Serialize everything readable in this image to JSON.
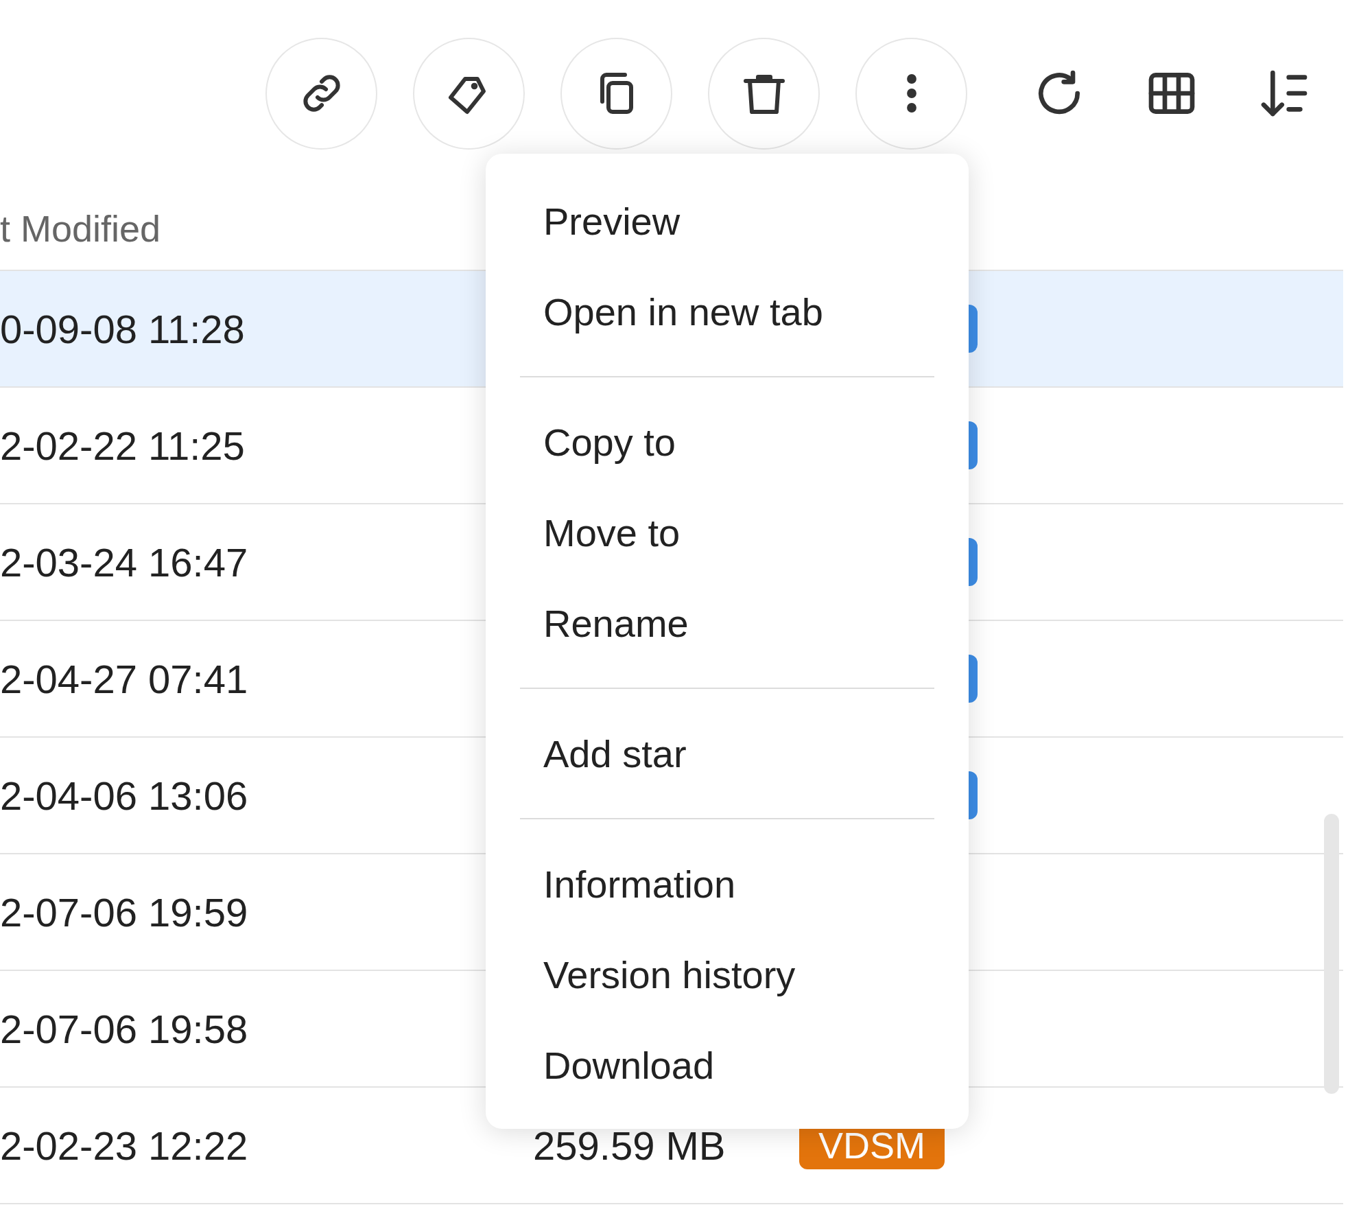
{
  "table": {
    "columns": [
      {
        "label": "t Modified"
      }
    ],
    "rows": [
      {
        "modified": "0-09-08 11:28",
        "selected": true,
        "tags": [
          {
            "color": "#3d8de6"
          }
        ]
      },
      {
        "modified": "2-02-22 11:25",
        "selected": false,
        "tags": [
          {
            "color": "#3d8de6"
          }
        ]
      },
      {
        "modified": "2-03-24 16:47",
        "selected": false,
        "tags": [
          {
            "color": "#3d8de6"
          }
        ]
      },
      {
        "modified": "2-04-27 07:41",
        "selected": false,
        "tags": [
          {
            "color": "#3d8de6"
          }
        ]
      },
      {
        "modified": "2-04-06 13:06",
        "selected": false,
        "tags": [
          {
            "color": "#3d8de6"
          }
        ]
      },
      {
        "modified": "2-07-06 19:59",
        "selected": false,
        "tags": []
      },
      {
        "modified": "2-07-06 19:58",
        "selected": false,
        "tags": []
      },
      {
        "modified": "2-02-23 12:22",
        "selected": false,
        "size": "259.59 MB",
        "tags": [
          {
            "label": "VDSM",
            "color": "#e3740c"
          }
        ]
      }
    ]
  },
  "context_menu": {
    "groups": [
      [
        "Preview",
        "Open in new tab"
      ],
      [
        "Copy to",
        "Move to",
        "Rename"
      ],
      [
        "Add star"
      ],
      [
        "Information",
        "Version history",
        "Download"
      ]
    ]
  }
}
